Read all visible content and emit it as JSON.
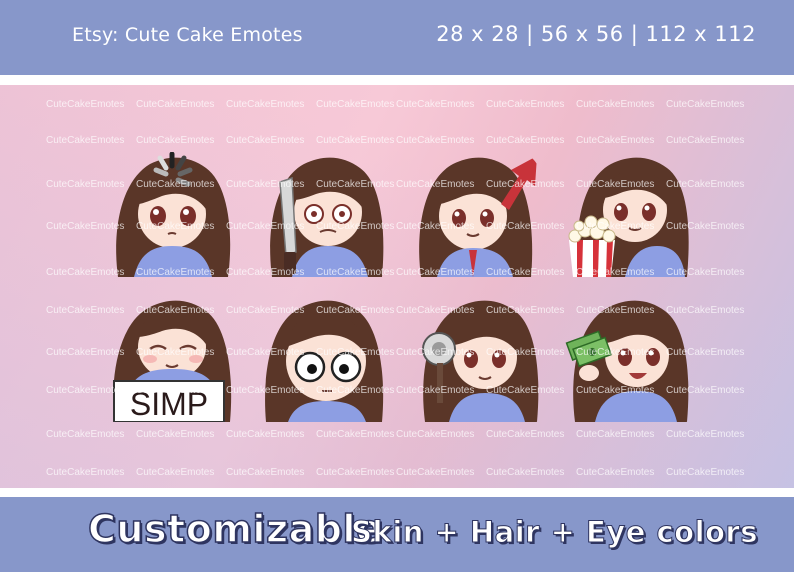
{
  "header": {
    "shop": "Etsy: Cute Cake Emotes",
    "sizes": "28 x 28 | 56 x 56 | 112 x 112"
  },
  "watermark": "CuteCakeEmotes",
  "emotes": [
    {
      "name": "loading",
      "description": "loading spinner over head"
    },
    {
      "name": "knife",
      "description": "holding a knife"
    },
    {
      "name": "stonks",
      "description": "red arrow going up"
    },
    {
      "name": "popcorn",
      "description": "eating popcorn"
    },
    {
      "name": "simp",
      "description": "holding SIMP sign",
      "sign_text": "SIMP"
    },
    {
      "name": "stare",
      "description": "wide eyed stare"
    },
    {
      "name": "ban",
      "description": "holding a hammer"
    },
    {
      "name": "money",
      "description": "holding cash"
    }
  ],
  "footer": {
    "left": "Customizable",
    "right": "Skin + Hair + Eye colors"
  },
  "colors": {
    "bar": "#8797ca",
    "hair": "#5a3628",
    "skin": "#fbe2d6",
    "shirt": "#8d9ee3",
    "eye": "#7a2f2a"
  }
}
